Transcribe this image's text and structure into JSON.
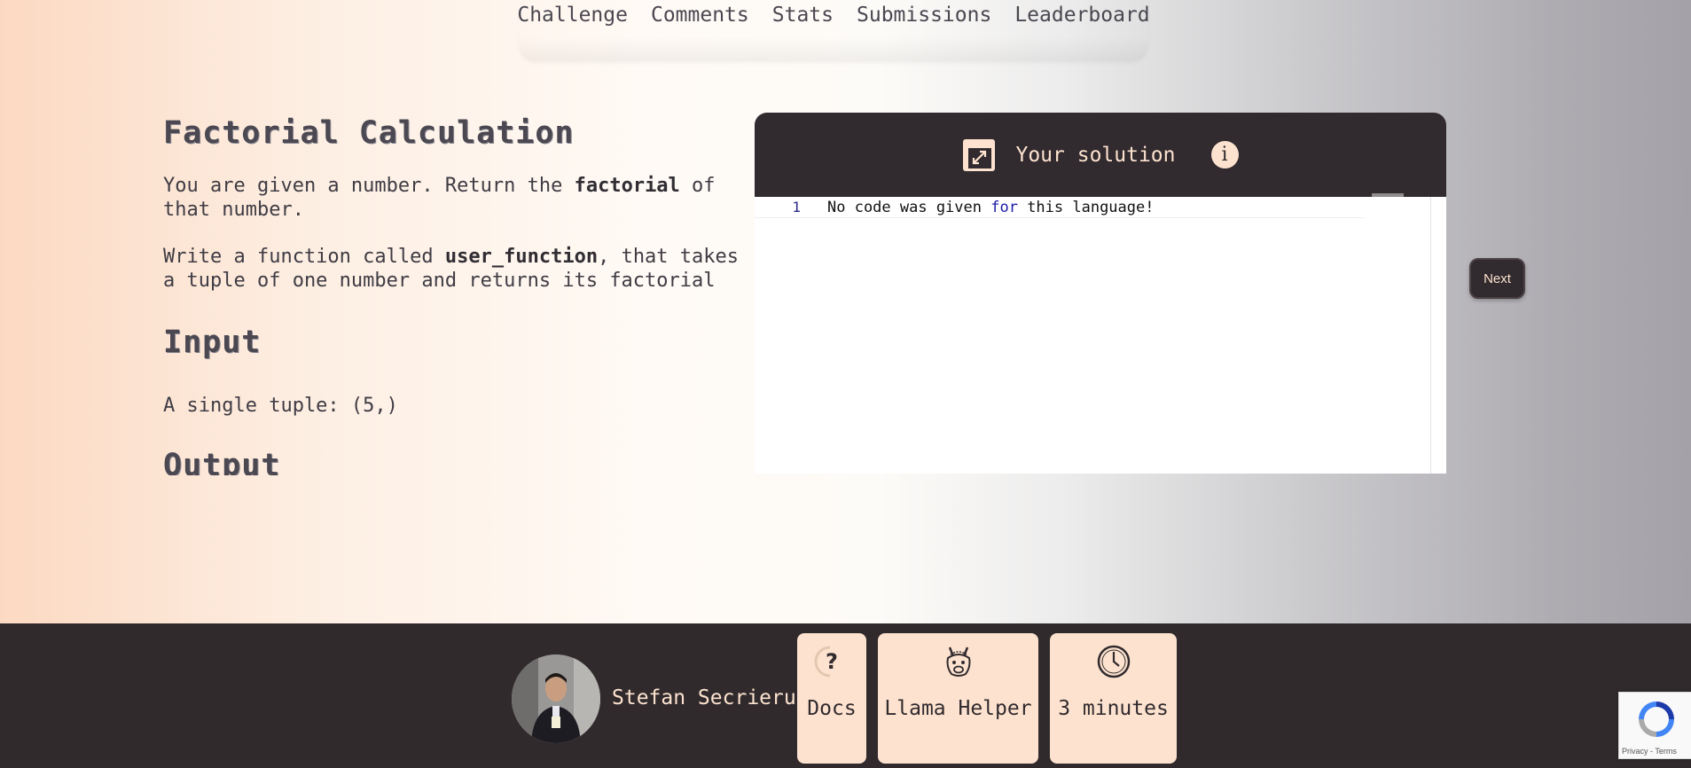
{
  "nav": {
    "items": [
      "Challenge",
      "Comments",
      "Stats",
      "Submissions",
      "Leaderboard"
    ]
  },
  "problem": {
    "title": "Factorial Calculation",
    "desc_before": "You are given a number. Return the ",
    "desc_bold": "factorial",
    "desc_after": " of that number.",
    "func_before": "Write a function called ",
    "func_bold": "user_function",
    "func_after": ", that takes a tuple of one number and returns its factorial",
    "input_heading": "Input",
    "input_text": "A single tuple: (5,)",
    "output_heading": "Output"
  },
  "editor": {
    "title": "Your solution",
    "line_number": "1",
    "code_before": "No code was given ",
    "code_keyword": "for",
    "code_after": " this language!"
  },
  "next_label": "Next",
  "footer": {
    "username": "Stefan Secrieru",
    "docs_label": "Docs",
    "docs_icon_text": "?",
    "llama_label": "Llama Helper",
    "timer_label": "3 minutes"
  },
  "recaptcha": {
    "text": "Privacy - Terms"
  },
  "colors": {
    "dark": "#312a2e",
    "peach": "#fde3cf"
  },
  "icons": {
    "expand": "expand-icon",
    "info": "info-icon",
    "docs": "question-icon",
    "llama": "llama-icon",
    "timer": "clock-icon"
  }
}
